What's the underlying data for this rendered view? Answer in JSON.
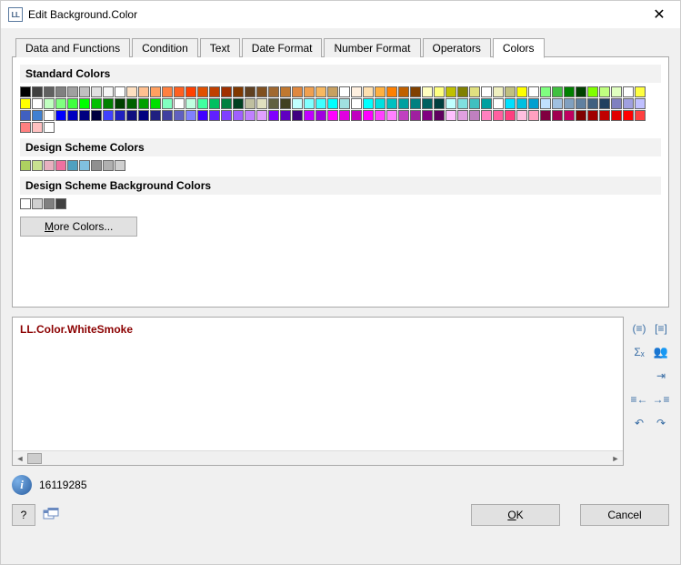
{
  "window": {
    "title": "Edit Background.Color"
  },
  "tabs": [
    {
      "label": "Data and Functions",
      "active": false
    },
    {
      "label": "Condition",
      "active": false
    },
    {
      "label": "Text",
      "active": false
    },
    {
      "label": "Date Format",
      "active": false
    },
    {
      "label": "Number Format",
      "active": false
    },
    {
      "label": "Operators",
      "active": false
    },
    {
      "label": "Colors",
      "active": true
    }
  ],
  "sections": {
    "standard": {
      "title": "Standard Colors"
    },
    "design": {
      "title": "Design Scheme Colors"
    },
    "designBg": {
      "title": "Design Scheme Background Colors"
    }
  },
  "standard_colors": [
    "#000000",
    "#404040",
    "#606060",
    "#808080",
    "#a0a0a0",
    "#c0c0c0",
    "#e0e0e0",
    "#f5f5f5",
    "#ffffff",
    "#ffe0c0",
    "#ffc090",
    "#ffa060",
    "#ff8040",
    "#ff6020",
    "#ff4000",
    "#e05000",
    "#c04000",
    "#a03000",
    "#803800",
    "#604020",
    "#805020",
    "#a06830",
    "#c07830",
    "#e08840",
    "#f0a050",
    "#f8b860",
    "#c8a060",
    "#ffffff",
    "#fff0e0",
    "#ffe0b0",
    "#ffb040",
    "#ff8000",
    "#c06000",
    "#804000",
    "#ffffc0",
    "#ffff80",
    "#c0c000",
    "#808000",
    "#e0e080",
    "#ffffff",
    "#f0f0c0",
    "#c0c080",
    "#ffff00",
    "#ffffff",
    "#80ff80",
    "#40c040",
    "#008000",
    "#004000",
    "#80ff00",
    "#c0ff80",
    "#e0ffc0",
    "#ffffff",
    "#ffff40",
    "#ffff00",
    "#ffffff",
    "#c0ffc0",
    "#80ff80",
    "#40ff40",
    "#00ff00",
    "#00c000",
    "#008000",
    "#004000",
    "#006000",
    "#00a000",
    "#00e000",
    "#80ffc0",
    "#ffffff",
    "#c0ffe0",
    "#40ffa0",
    "#00c060",
    "#008040",
    "#004020",
    "#c0c0a0",
    "#e0e0c0",
    "#606040",
    "#404020",
    "#c0ffff",
    "#80ffff",
    "#40ffff",
    "#00ffff",
    "#a0e0e0",
    "#ffffff",
    "#00ffff",
    "#00e0e0",
    "#00c0c0",
    "#00a0a0",
    "#008080",
    "#006060",
    "#004040",
    "#c0ffff",
    "#80e0e0",
    "#40c0c0",
    "#00a0a0",
    "#ffffff",
    "#00e0ff",
    "#00c0e0",
    "#009fcf",
    "#c0e0ff",
    "#a0c0e0",
    "#80a0c0",
    "#6080a0",
    "#406080",
    "#204060",
    "#8080c0",
    "#a0a0e0",
    "#c0c0ff",
    "#4060c0",
    "#4080d0",
    "#ffffff",
    "#0000ff",
    "#0000c0",
    "#000080",
    "#000040",
    "#4040ff",
    "#2020c0",
    "#101080",
    "#000080",
    "#202080",
    "#4040a0",
    "#6060c0",
    "#8080ff",
    "#4000ff",
    "#6020ff",
    "#8040ff",
    "#a060ff",
    "#c080ff",
    "#e0a0ff",
    "#8000ff",
    "#6000c0",
    "#400080",
    "#c000ff",
    "#a000e0",
    "#ff00ff",
    "#e000e0",
    "#c000c0",
    "#ff00ff",
    "#ff40ff",
    "#ff80ff",
    "#c040c0",
    "#a020a0",
    "#800080",
    "#600060",
    "#ffc0ff",
    "#e0a0e0",
    "#c080c0",
    "#ff80c0",
    "#ff60a0",
    "#ff4080",
    "#ffc0e0",
    "#ffa0c0",
    "#800040",
    "#a00050",
    "#c00060",
    "#800000",
    "#a00000",
    "#c00000",
    "#e00000",
    "#ff0000",
    "#ff4040",
    "#ff8080",
    "#ffc0c0",
    "#ffffff"
  ],
  "design_colors": [
    "#aed060",
    "#c8e090",
    "#e8b0c0",
    "#f070a0",
    "#50a0c0",
    "#80c0e0",
    "#909090",
    "#b0b0b0",
    "#d0d0d0"
  ],
  "design_bg_colors": [
    "#ffffff",
    "#d0d0d0",
    "#808080",
    "#404040"
  ],
  "more_colors": {
    "label_u": "M",
    "label_rest": "ore Colors..."
  },
  "expression": {
    "text": "LL.Color.WhiteSmoke"
  },
  "status": {
    "value": "16119285"
  },
  "side_icons": [
    [
      "wrap-parentheses-icon",
      "wrap-brackets-icon"
    ],
    [
      "sum-icon",
      "people-icon"
    ],
    [
      "indent-right-icon"
    ],
    [
      "outdent-icon",
      "indent-icon"
    ],
    [
      "undo-icon",
      "redo-icon"
    ]
  ],
  "buttons": {
    "ok_u": "O",
    "ok_rest": "K",
    "cancel": "Cancel"
  }
}
